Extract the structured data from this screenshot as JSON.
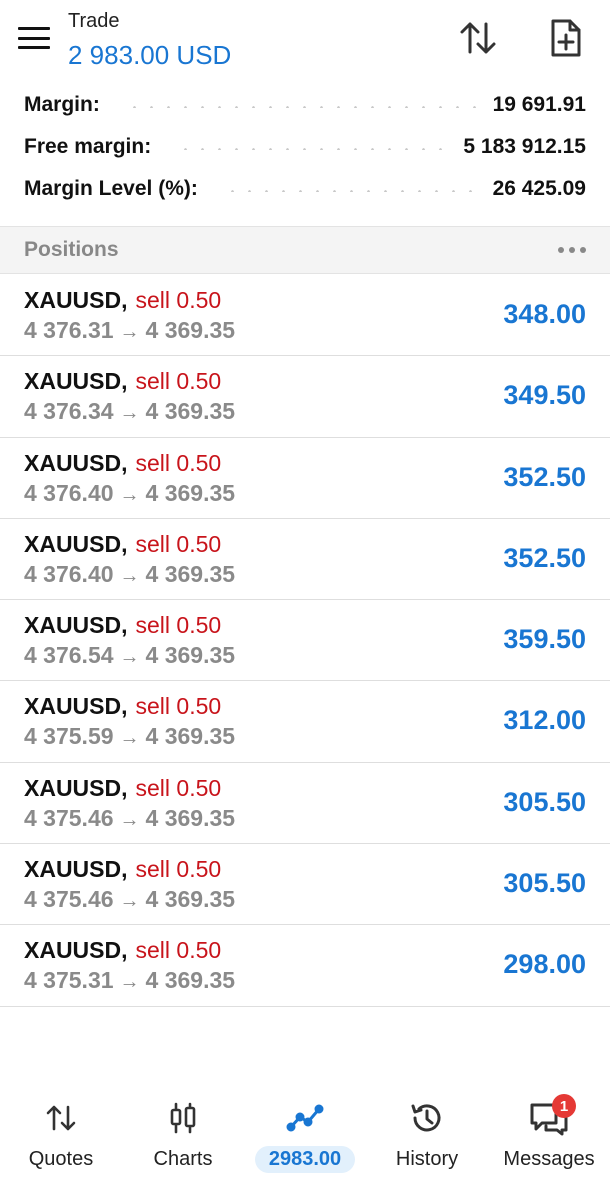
{
  "header": {
    "title": "Trade",
    "balance": "2 983.00 USD"
  },
  "summary": [
    {
      "label": "Margin:",
      "value": "19 691.91"
    },
    {
      "label": "Free margin:",
      "value": "5 183 912.15"
    },
    {
      "label": "Margin Level (%):",
      "value": "26 425.09"
    }
  ],
  "positions_section": {
    "title": "Positions"
  },
  "positions": [
    {
      "symbol": "XAUUSD",
      "side": "sell 0.50",
      "open": "4 376.31",
      "current": "4 369.35",
      "profit": "348.00"
    },
    {
      "symbol": "XAUUSD",
      "side": "sell 0.50",
      "open": "4 376.34",
      "current": "4 369.35",
      "profit": "349.50"
    },
    {
      "symbol": "XAUUSD",
      "side": "sell 0.50",
      "open": "4 376.40",
      "current": "4 369.35",
      "profit": "352.50"
    },
    {
      "symbol": "XAUUSD",
      "side": "sell 0.50",
      "open": "4 376.40",
      "current": "4 369.35",
      "profit": "352.50"
    },
    {
      "symbol": "XAUUSD",
      "side": "sell 0.50",
      "open": "4 376.54",
      "current": "4 369.35",
      "profit": "359.50"
    },
    {
      "symbol": "XAUUSD",
      "side": "sell 0.50",
      "open": "4 375.59",
      "current": "4 369.35",
      "profit": "312.00"
    },
    {
      "symbol": "XAUUSD",
      "side": "sell 0.50",
      "open": "4 375.46",
      "current": "4 369.35",
      "profit": "305.50"
    },
    {
      "symbol": "XAUUSD",
      "side": "sell 0.50",
      "open": "4 375.46",
      "current": "4 369.35",
      "profit": "305.50"
    },
    {
      "symbol": "XAUUSD",
      "side": "sell 0.50",
      "open": "4 375.31",
      "current": "4 369.35",
      "profit": "298.00"
    }
  ],
  "nav": {
    "items": [
      {
        "label": "Quotes",
        "icon": "quotes-icon"
      },
      {
        "label": "Charts",
        "icon": "charts-icon"
      },
      {
        "label": "2983.00",
        "icon": "trade-icon",
        "active": true
      },
      {
        "label": "History",
        "icon": "history-icon"
      },
      {
        "label": "Messages",
        "icon": "messages-icon",
        "badge": "1"
      }
    ]
  },
  "colors": {
    "accent": "#1976d2",
    "sell": "#c8141b",
    "badge": "#e53935",
    "muted": "#8a8a8a"
  }
}
